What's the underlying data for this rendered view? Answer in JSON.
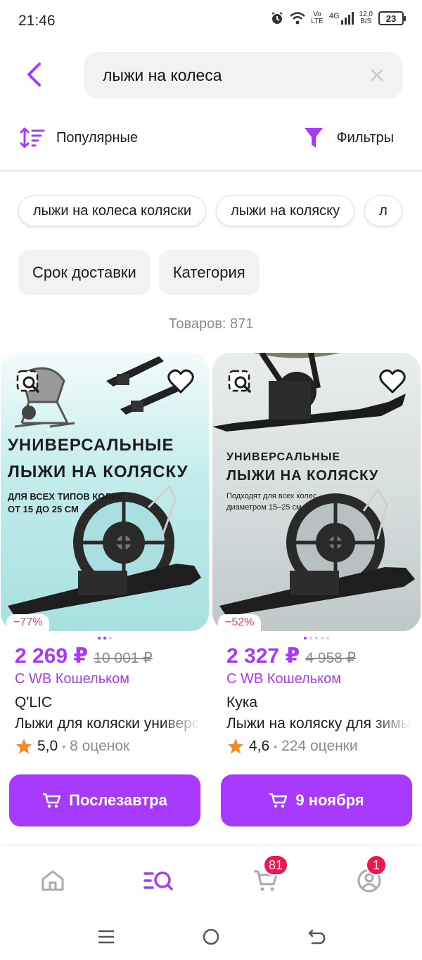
{
  "status_bar": {
    "time": "21:46",
    "network": "4G",
    "volte_top": "Vo",
    "volte_bottom": "LTE",
    "speed_top": "12,0",
    "speed_bottom": "B/S",
    "battery": "23"
  },
  "search": {
    "query": "лыжи на колеса"
  },
  "toolbar": {
    "sort_label": "Популярные",
    "filter_label": "Фильтры"
  },
  "suggestions": [
    {
      "label": "лыжи на колеса коляски"
    },
    {
      "label": "лыжи на коляску"
    },
    {
      "label": "л"
    }
  ],
  "filter_pills": [
    {
      "label": "Срок доставки"
    },
    {
      "label": "Категория"
    }
  ],
  "results": {
    "count_text": "Товаров: 871"
  },
  "products": [
    {
      "image_title_1": "УНИВЕРСАЛЬНЫЕ",
      "image_title_2": "ЛЫЖИ НА КОЛЯСКУ",
      "image_sub_1": "ДЛЯ ВСЕХ ТИПОВ КОЛЕС",
      "image_sub_2": "ОТ 15 ДО 25 СМ",
      "discount": "−77%",
      "price": "2 269 ₽",
      "old_price": "10 001 ₽",
      "wallet": "С WB Кошельком",
      "brand": "Q'LIC",
      "name": "Лыжи для коляски универсальные",
      "rating": "5,0",
      "reviews": "8 оценок",
      "delivery": "Послезавтра"
    },
    {
      "image_title_1": "УНИВЕРСАЛЬНЫЕ",
      "image_title_2": "ЛЫЖИ НА КОЛЯСКУ",
      "image_sub_1": "Подходят для всех колес",
      "image_sub_2": "диаметром 15–25 см",
      "discount": "−52%",
      "price": "2 327 ₽",
      "old_price": "4 958 ₽",
      "wallet": "С WB Кошельком",
      "brand": "Кука",
      "name": "Лыжи на коляску для зимы",
      "rating": "4,6",
      "reviews": "224 оценки",
      "delivery": "9 ноября"
    }
  ],
  "bottom_nav": {
    "cart_badge": "81",
    "profile_badge": "1"
  },
  "colors": {
    "accent": "#a73afd",
    "discount": "#ea3d65",
    "badge": "#f3134e",
    "star": "#f58b1f"
  }
}
